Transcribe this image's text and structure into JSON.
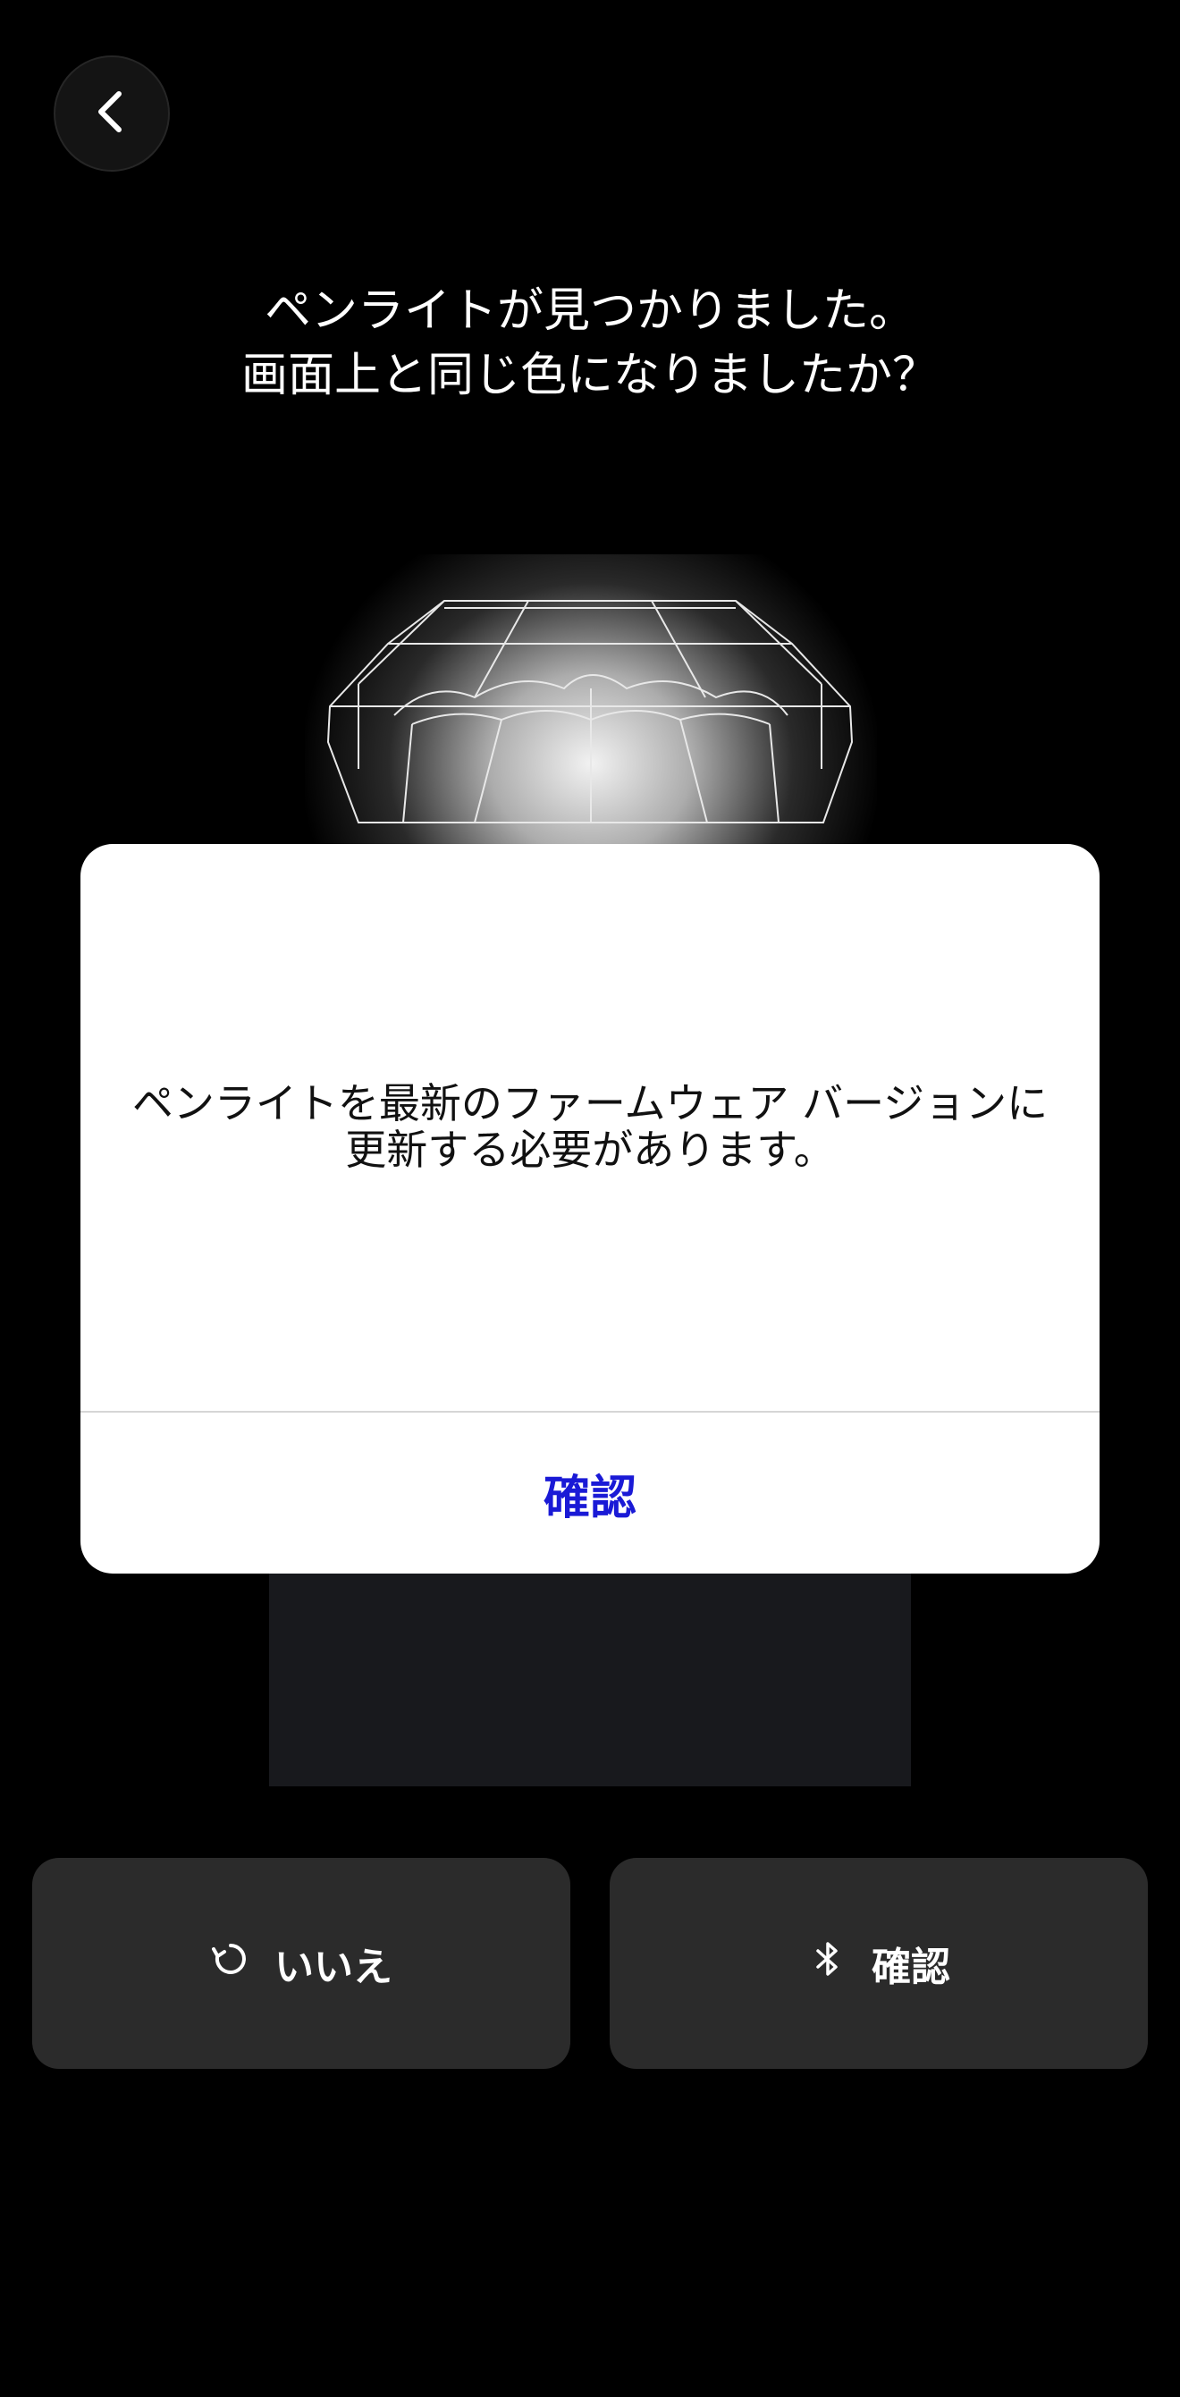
{
  "header": {
    "back_icon": "chevron-left-icon"
  },
  "headline": {
    "line1": "ペンライトが見つかりました。",
    "line2": "画面上と同じ色になりましたか？"
  },
  "dialog": {
    "message_line1": "ペンライトを最新のファームウェア バージョンに",
    "message_line2": "更新する必要があります。",
    "confirm_label": "確認",
    "confirm_color": "#1a1ad6"
  },
  "actions": {
    "no_label": "いいえ",
    "no_icon": "refresh-icon",
    "yes_label": "確認",
    "yes_icon": "bluetooth-icon"
  },
  "colors": {
    "background": "#000000",
    "button_bg": "#2b2b2b",
    "dialog_bg": "#ffffff"
  }
}
